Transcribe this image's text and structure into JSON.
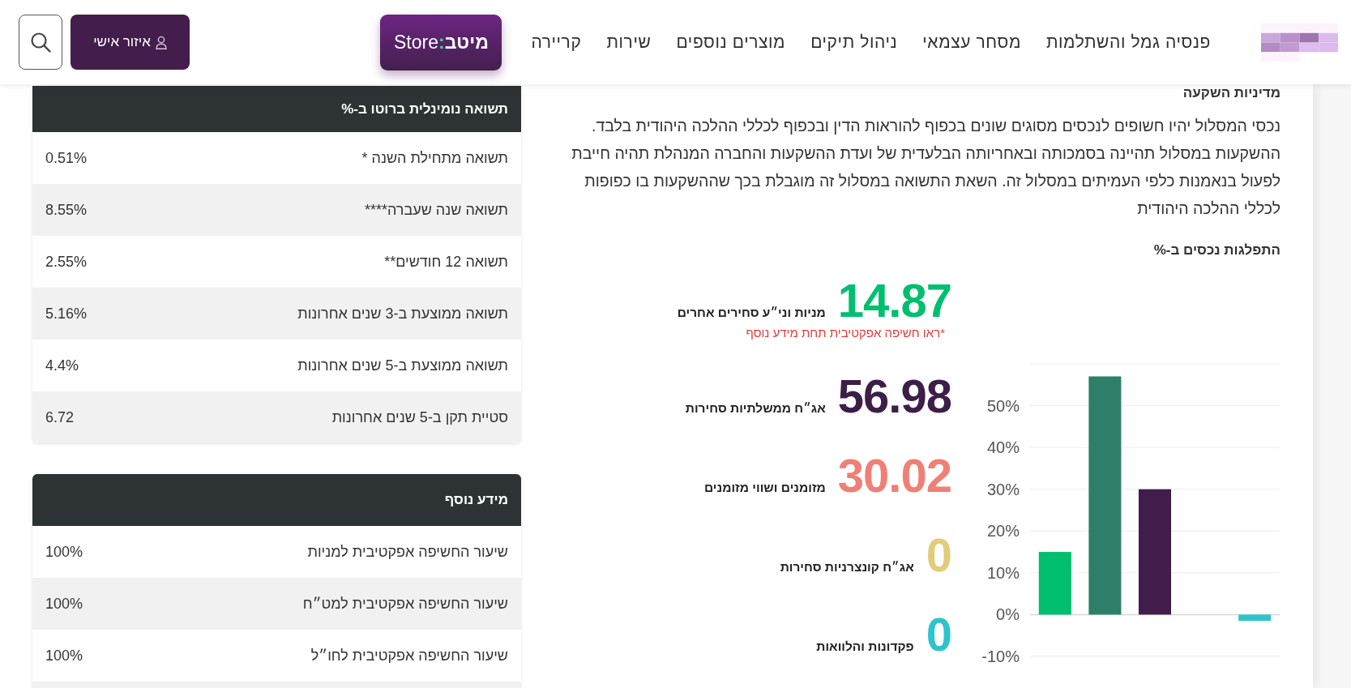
{
  "header": {
    "nav_links": [
      "פנסיה גמל והשתלמות",
      "מסחר עצמאי",
      "ניהול תיקים",
      "מוצרים נוספים",
      "שירות",
      "קריירה"
    ],
    "store_button": {
      "brand": "מיטב",
      "separator": ":",
      "suffix": "Store"
    },
    "personal_area_button": "איזור אישי"
  },
  "returns_table": {
    "title": "תשואה נומינלית ברוטו ב-%",
    "rows": [
      {
        "label": "תשואה מתחילת השנה *",
        "value": "0.51%"
      },
      {
        "label": "תשואה שנה שעברה****",
        "value": "8.55%"
      },
      {
        "label": "תשואה 12 חודשים**",
        "value": "2.55%"
      },
      {
        "label": "תשואה ממוצעת ב-3 שנים אחרונות",
        "value": "5.16%"
      },
      {
        "label": "תשואה ממוצעת ב-5 שנים אחרונות",
        "value": "4.4%"
      },
      {
        "label": "סטיית תקן ב-5 שנים אחרונות",
        "value": "6.72"
      }
    ]
  },
  "additional_info_table": {
    "title": "מידע נוסף",
    "rows": [
      {
        "label": "שיעור החשיפה אפקטיבית למניות",
        "value": "100%"
      },
      {
        "label": "שיעור החשיפה אפקטיבית למט״ח",
        "value": "100%"
      },
      {
        "label": "שיעור החשיפה אפקטיבית לחו״ל",
        "value": "100%"
      }
    ]
  },
  "investment_policy": {
    "title": "מדיניות השקעה",
    "text": "נכסי המסלול יהיו חשופים לנכסים מסוגים שונים בכפוף להוראות הדין ובכפוף לכללי ההלכה היהודית בלבד. ההשקעות במסלול תהיינה בסמכותה ובאחריותה הבלעדית של ועדת ההשקעות והחברה המנהלת תהיה חייבת לפעול בנאמנות כלפי העמיתים במסלול זה. השאת התשואה במסלול זה מוגבלת בכך שההשקעות בו כפופות לכללי ההלכה היהודית"
  },
  "asset_allocation": {
    "title": "התפלגות נכסים ב-%",
    "items": [
      {
        "value": "14.87",
        "label": "מניות וני״ע סחירים אחרים",
        "color": "#00bf6f",
        "note": "*ראו חשיפה אפקטיבית תחת מידע נוסף"
      },
      {
        "value": "56.98",
        "label": "אג״ח ממשלתיות סחירות",
        "color": "#3c1f49"
      },
      {
        "value": "30.02",
        "label": "מזומנים ושווי מזומנים",
        "color": "#f07f76"
      },
      {
        "value": "0",
        "label": "אג״ח קונצרניות סחירות",
        "color": "#e2cb7a"
      },
      {
        "value": "0",
        "label": "פקדונות והלוואות",
        "color": "#2ec4cc"
      }
    ],
    "chart_data": {
      "type": "bar",
      "stacked": true,
      "grid": true,
      "ylim": [
        -10,
        60
      ],
      "yticks": [
        {
          "value": -10,
          "label": "-10%"
        },
        {
          "value": 0,
          "label": "0%"
        },
        {
          "value": 10,
          "label": "10%"
        },
        {
          "value": 20,
          "label": "20%"
        },
        {
          "value": 30,
          "label": "30%"
        },
        {
          "value": 40,
          "label": "40%"
        },
        {
          "value": 50,
          "label": "50%"
        }
      ],
      "series": [
        {
          "color": "#00bf6f",
          "values": [
            15,
            null,
            null,
            null,
            null
          ]
        },
        {
          "color": "#2e7f69",
          "values": [
            null,
            57,
            null,
            null,
            null
          ]
        },
        {
          "color": "#421d4b",
          "values": [
            null,
            null,
            30,
            null,
            null
          ]
        },
        {
          "values": [
            null,
            null,
            null,
            0,
            null
          ]
        },
        {
          "color": "#2ec4cc",
          "values": [
            null,
            null,
            null,
            null,
            -1.5
          ]
        }
      ]
    }
  }
}
